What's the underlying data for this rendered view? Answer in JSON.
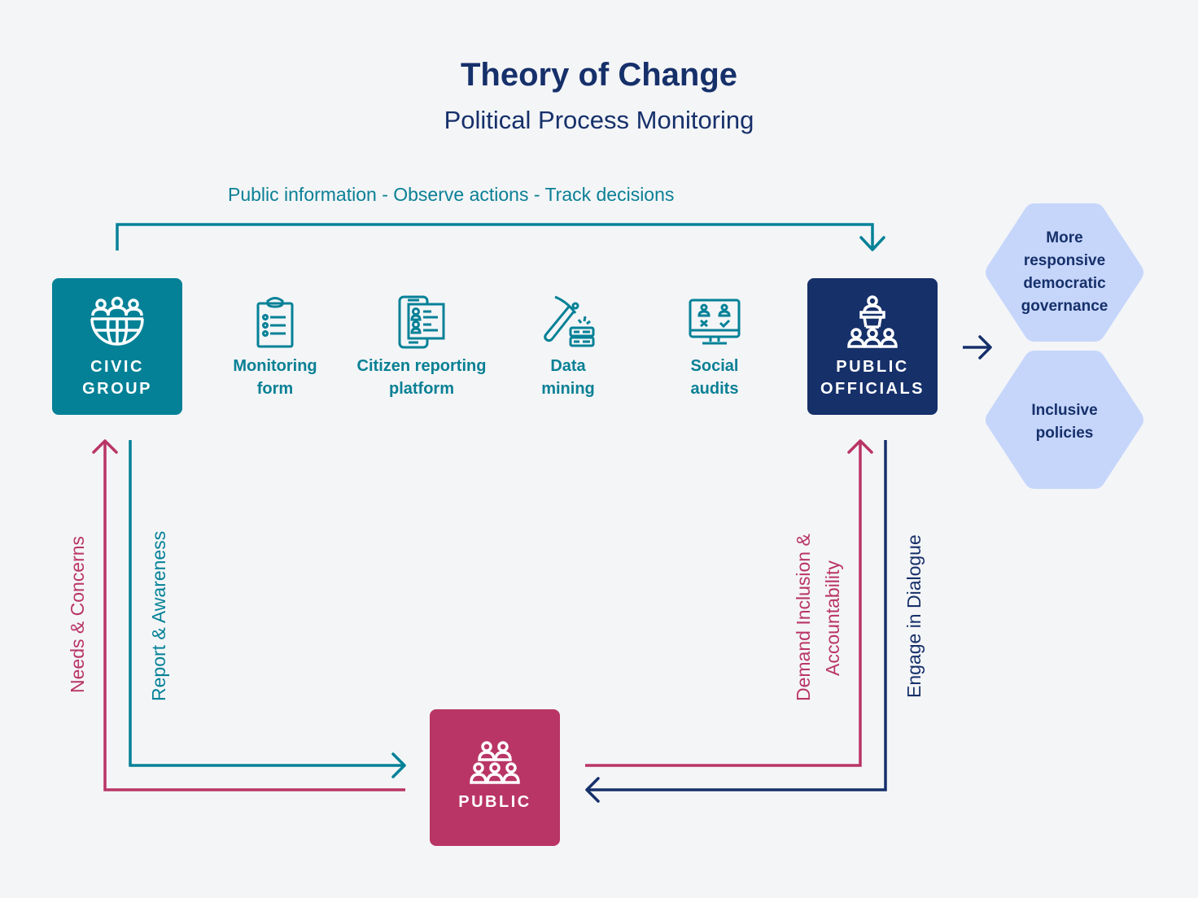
{
  "header": {
    "title": "Theory of Change",
    "subtitle": "Political Process Monitoring"
  },
  "colors": {
    "background": "#f4f5f7",
    "teal": "#048197",
    "navy": "#16306a",
    "crimson": "#b93565",
    "outcome_fill": "#c6d6fb"
  },
  "top_flow": {
    "label": "Public information - Observe actions - Track decisions"
  },
  "actors": {
    "civic_group": {
      "label_line1": "CIVIC",
      "label_line2": "GROUP",
      "icon": "globe-people-icon"
    },
    "public_officials": {
      "label_line1": "PUBLIC",
      "label_line2": "OFFICIALS",
      "icon": "podium-audience-icon"
    },
    "public": {
      "label": "PUBLIC",
      "icon": "crowd-icon"
    }
  },
  "tools": [
    {
      "line1": "Monitoring",
      "line2": "form",
      "icon": "clipboard-checklist-icon"
    },
    {
      "line1": "Citizen reporting",
      "line2": "platform",
      "icon": "phone-profiles-icon"
    },
    {
      "line1": "Data",
      "line2": "mining",
      "icon": "pickaxe-server-icon"
    },
    {
      "line1": "Social",
      "line2": "audits",
      "icon": "monitor-vote-icon"
    }
  ],
  "outcomes": [
    {
      "line1": "More",
      "line2": "responsive",
      "line3": "democratic",
      "line4": "governance"
    },
    {
      "line1": "Inclusive",
      "line2": "policies"
    }
  ],
  "flows": {
    "needs_concerns": "Needs & Concerns",
    "report_awareness": "Report & Awareness",
    "demand_line1": "Demand Inclusion &",
    "demand_line2": "Accountability",
    "engage_dialogue": "Engage in Dialogue"
  }
}
